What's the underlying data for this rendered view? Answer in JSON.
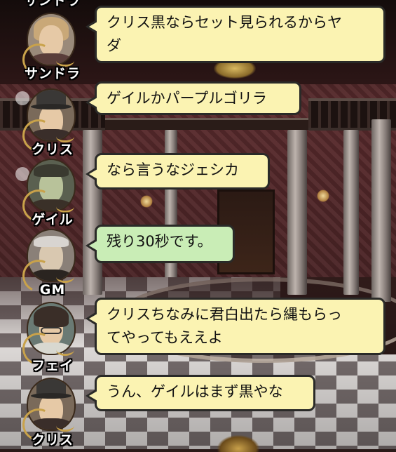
{
  "chat": {
    "top_partial_name": "サンドラ",
    "messages": [
      {
        "speaker": "サンドラ",
        "text_lines": [
          "クリス黒ならセット見られるからヤ",
          "ダ"
        ],
        "type": "player"
      },
      {
        "speaker": "クリス",
        "text_lines": [
          "ゲイルかパープルゴリラ"
        ],
        "type": "player"
      },
      {
        "speaker": "ゲイル",
        "text_lines": [
          "なら言うなジェシカ"
        ],
        "type": "player"
      },
      {
        "speaker": "GM",
        "text_lines": [
          "残り30秒です。"
        ],
        "type": "gm"
      },
      {
        "speaker": "フェイ",
        "text_lines": [
          "クリスちなみに君白出たら縄もらっ",
          "てやってもええよ"
        ],
        "type": "player"
      },
      {
        "speaker": "クリス",
        "text_lines": [
          "うん、ゲイルはまず黒やな"
        ],
        "type": "player"
      }
    ]
  },
  "colors": {
    "player_bubble": "#fbf3b2",
    "gm_bubble": "#c9edb6",
    "bubble_border": "#2a2a28",
    "ornament_gold": "#c9a24a"
  }
}
